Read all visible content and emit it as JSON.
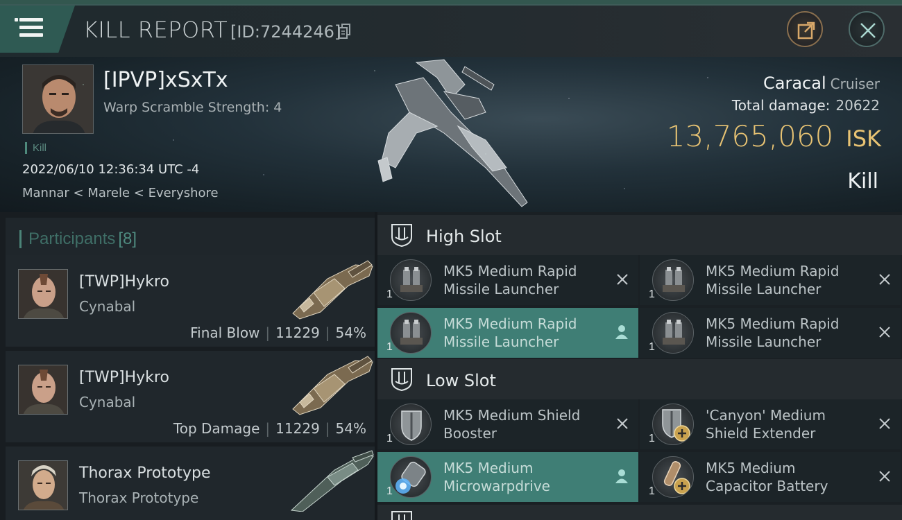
{
  "header": {
    "title": "KILL REPORT",
    "report_id": "[ID:7244246]"
  },
  "victim": {
    "name": "[IPVP]xSxTx",
    "warp_scramble": "Warp Scramble Strength: 4",
    "tag": "Kill",
    "datetime": "2022/06/10 12:36:34 UTC -4",
    "location": "Mannar < Marele < Everyshore",
    "ship_name": "Caracal",
    "ship_class": "Cruiser",
    "total_damage_label": "Total damage:",
    "total_damage": "20622",
    "isk_value": "13,765,060",
    "isk_unit": "ISK",
    "outcome": "Kill"
  },
  "participants": {
    "title": "Participants",
    "count": "[8]",
    "rows": [
      {
        "name": "[TWP]Hykro",
        "ship": "Cynabal",
        "role": "Final Blow",
        "damage": "11229",
        "percent": "54%"
      },
      {
        "name": "[TWP]Hykro",
        "ship": "Cynabal",
        "role": "Top Damage",
        "damage": "11229",
        "percent": "54%"
      },
      {
        "name": "Thorax Prototype",
        "ship": "Thorax Prototype"
      }
    ]
  },
  "fitting": {
    "high_slot": {
      "label": "High Slot",
      "modules": [
        {
          "name": "MK5 Medium Rapid Missile Launcher",
          "qty": "1",
          "status": "destroyed"
        },
        {
          "name": "MK5 Medium Rapid Missile Launcher",
          "qty": "1",
          "status": "destroyed"
        },
        {
          "name": "MK5 Medium Rapid Missile Launcher",
          "qty": "1",
          "status": "dropped"
        },
        {
          "name": "MK5 Medium Rapid Missile Launcher",
          "qty": "1",
          "status": "destroyed"
        }
      ]
    },
    "low_slot": {
      "label": "Low Slot",
      "modules": [
        {
          "name": "MK5 Medium Shield Booster",
          "qty": "1",
          "status": "destroyed"
        },
        {
          "name": "'Canyon' Medium Shield Extender",
          "qty": "1",
          "status": "destroyed"
        },
        {
          "name": "MK5 Medium Microwarpdrive",
          "qty": "1",
          "status": "dropped"
        },
        {
          "name": "MK5 Medium Capacitor Battery",
          "qty": "1",
          "status": "destroyed"
        }
      ]
    }
  },
  "colors": {
    "accent_teal": "#3f7e75",
    "isk_gold": "#e8c373",
    "header_tab": "#2f5a53"
  },
  "icons": [
    "menu-icon",
    "copy-icon",
    "share-icon",
    "close-icon",
    "slot-icon",
    "destroyed-x-icon",
    "dropped-user-icon"
  ]
}
